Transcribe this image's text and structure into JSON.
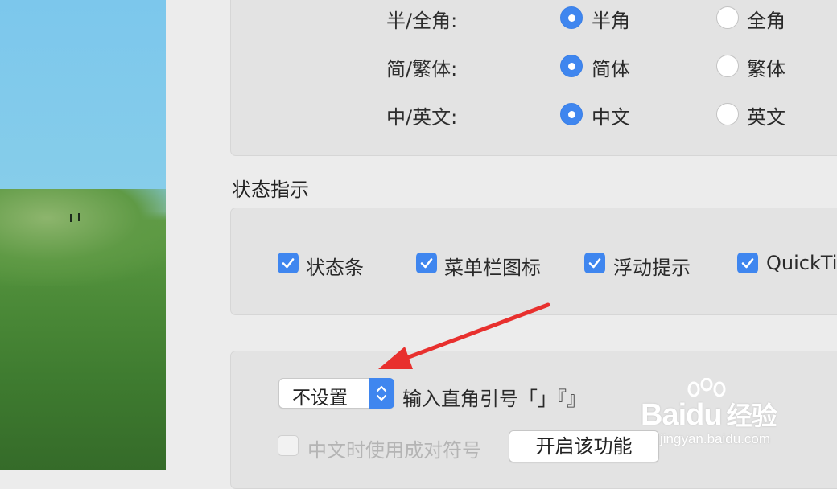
{
  "input_mode": {
    "rows": [
      {
        "label": "半/全角:",
        "options": [
          "半角",
          "全角"
        ],
        "selected": 0
      },
      {
        "label": "简/繁体:",
        "options": [
          "简体",
          "繁体"
        ],
        "selected": 0
      },
      {
        "label": "中/英文:",
        "options": [
          "中文",
          "英文"
        ],
        "selected": 0
      }
    ]
  },
  "status_indicator": {
    "title": "状态指示",
    "checkboxes": [
      {
        "label": "状态条",
        "checked": true
      },
      {
        "label": "菜单栏图标",
        "checked": true
      },
      {
        "label": "浮动提示",
        "checked": true
      },
      {
        "label": "QuickTi",
        "checked": true
      }
    ]
  },
  "quotes": {
    "popup_value": "不设置",
    "popup_caption": "输入直角引号「」『』",
    "pair_symbols_label": "中文时使用成对符号",
    "pair_symbols_checked": false,
    "enable_button_label": "开启该功能"
  },
  "watermark": {
    "brand": "Bai",
    "brand_suffix": "du",
    "brand_cn": "经验",
    "url": "jingyan.baidu.com"
  },
  "colors": {
    "accent": "#3f86ef",
    "arrow": "#e8302e"
  }
}
